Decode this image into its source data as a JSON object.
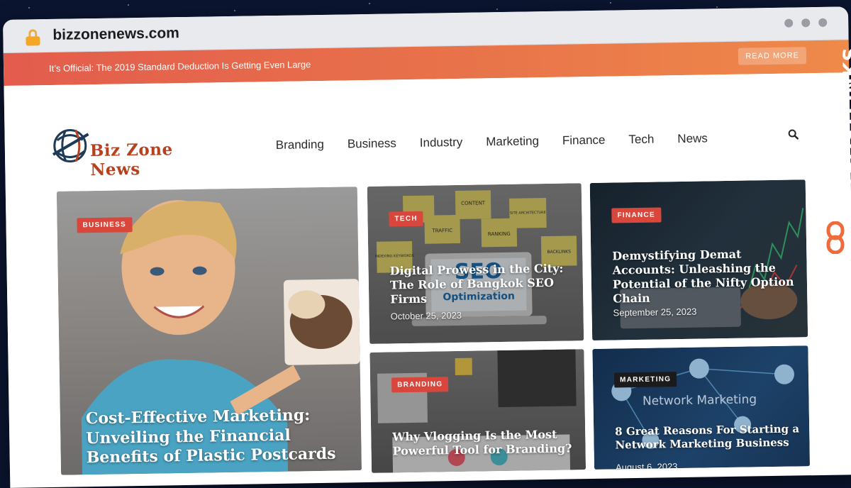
{
  "browser": {
    "url": "bizzonenews.com"
  },
  "topbar": {
    "headline": "It’s Official: The 2019 Standard Deduction Is Getting Even Large",
    "read_more": "READ MORE"
  },
  "site": {
    "logo_text": "Biz Zone News",
    "nav": [
      "Branding",
      "Business",
      "Industry",
      "Marketing",
      "Finance",
      "Tech",
      "News"
    ]
  },
  "cards": [
    {
      "category": "BUSINESS",
      "title": "Cost-Effective Marketing: Unveiling the Financial Benefits of Plastic Postcards",
      "date": ""
    },
    {
      "category": "TECH",
      "title": "Digital Prowess in the City: The Role of Bangkok SEO Firms",
      "date": "October 25, 2023",
      "image_text": {
        "seo": "SEO",
        "optimization": "Optimization",
        "notes": [
          "CONTENT",
          "TRAFFIC",
          "RANKING",
          "INDEXING KEYWORDS",
          "SITE ARCHITECTURE",
          "BACKLINKS"
        ]
      }
    },
    {
      "category": "FINANCE",
      "title": "Demystifying Demat Accounts: Unleashing the Potential of the Nifty Option Chain",
      "date": "September 25, 2023"
    },
    {
      "category": "BRANDING",
      "title": "Why Vlogging Is the Most Powerful Tool for Branding?",
      "date": ""
    },
    {
      "category": "MARKETING",
      "title": "8 Great Reasons For Starting a Network Marketing Business",
      "date": "August 6, 2023",
      "image_text": "Network Marketing"
    }
  ],
  "side_brand": {
    "text": "GUESTPOSTLINKS"
  },
  "colors": {
    "topbar_start": "#e35c4d",
    "topbar_end": "#ef8a4a",
    "badge_red": "#d9473c",
    "logo_red": "#b5411e"
  },
  "icons": {
    "lock": "lock-icon",
    "search": "search-icon",
    "link": "link-icon"
  }
}
